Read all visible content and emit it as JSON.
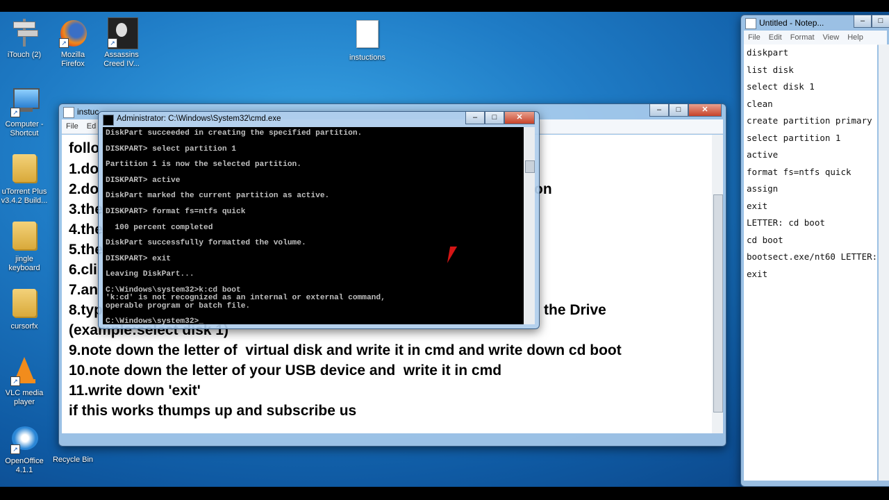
{
  "desktop": {
    "icons": [
      {
        "name": "itouch-icon",
        "label": "iTouch (2)"
      },
      {
        "name": "firefox-icon",
        "label": "Mozilla Firefox"
      },
      {
        "name": "assassins-creed-icon",
        "label": "Assassins Creed IV..."
      },
      {
        "name": "instructions-file-icon",
        "label": "instuctions"
      },
      {
        "name": "computer-shortcut-icon",
        "label": "Computer - Shortcut"
      },
      {
        "name": "utorrent-icon",
        "label": "uTorrent Plus v3.4.2 Build..."
      },
      {
        "name": "jingle-keyboard-icon",
        "label": "jingle keyboard"
      },
      {
        "name": "cursorfx-icon",
        "label": "cursorfx"
      },
      {
        "name": "vlc-icon",
        "label": "VLC media player"
      },
      {
        "name": "openoffice-icon",
        "label": "OpenOffice 4.1.1"
      },
      {
        "name": "recycle-bin-icon",
        "label": "Recycle Bin"
      }
    ]
  },
  "doc_window": {
    "title": "instuc",
    "menu": [
      "File",
      "Ed"
    ],
    "lines_left": [
      "follo",
      "1.do",
      "2.do",
      "3.the",
      "4.the",
      "5.the",
      "6.cli",
      "7.an",
      "8.typ"
    ],
    "line_2_tail": "on",
    "line_8_tail": "the Drive",
    "line_8b": "(example:select disk 1)",
    "lines_full": [
      "9.note down the letter of  virtual disk and write it in cmd and write down cd boot",
      "10.note down the letter of your USB device and  write it in cmd",
      "11.write down 'exit'",
      "if this works thumps up and subscribe us"
    ]
  },
  "cmd_window": {
    "title": "Administrator: C:\\Windows\\System32\\cmd.exe",
    "lines": [
      "DiskPart succeeded in creating the specified partition.",
      "",
      "DISKPART> select partition 1",
      "",
      "Partition 1 is now the selected partition.",
      "",
      "DISKPART> active",
      "",
      "DiskPart marked the current partition as active.",
      "",
      "DISKPART> format fs=ntfs quick",
      "",
      "  100 percent completed",
      "",
      "DiskPart successfully formatted the volume.",
      "",
      "DISKPART> exit",
      "",
      "Leaving DiskPart...",
      "",
      "C:\\Windows\\system32>k:cd boot",
      "'k:cd' is not recognized as an internal or external command,",
      "operable program or batch file.",
      "",
      "C:\\Windows\\system32>_"
    ]
  },
  "notepad": {
    "title": "Untitled - Notep...",
    "menu": [
      "File",
      "Edit",
      "Format",
      "View",
      "Help"
    ],
    "lines": [
      "diskpart",
      "list disk",
      "select disk 1",
      "clean",
      "create partition primary",
      "select partition 1",
      "active",
      "format fs=ntfs quick",
      "assign",
      "exit",
      "LETTER: cd boot",
      "cd boot",
      "bootsect.exe/nt60 LETTER:",
      "exit"
    ]
  },
  "window_controls": {
    "minimize": "–",
    "maximize": "□",
    "close": "✕"
  }
}
